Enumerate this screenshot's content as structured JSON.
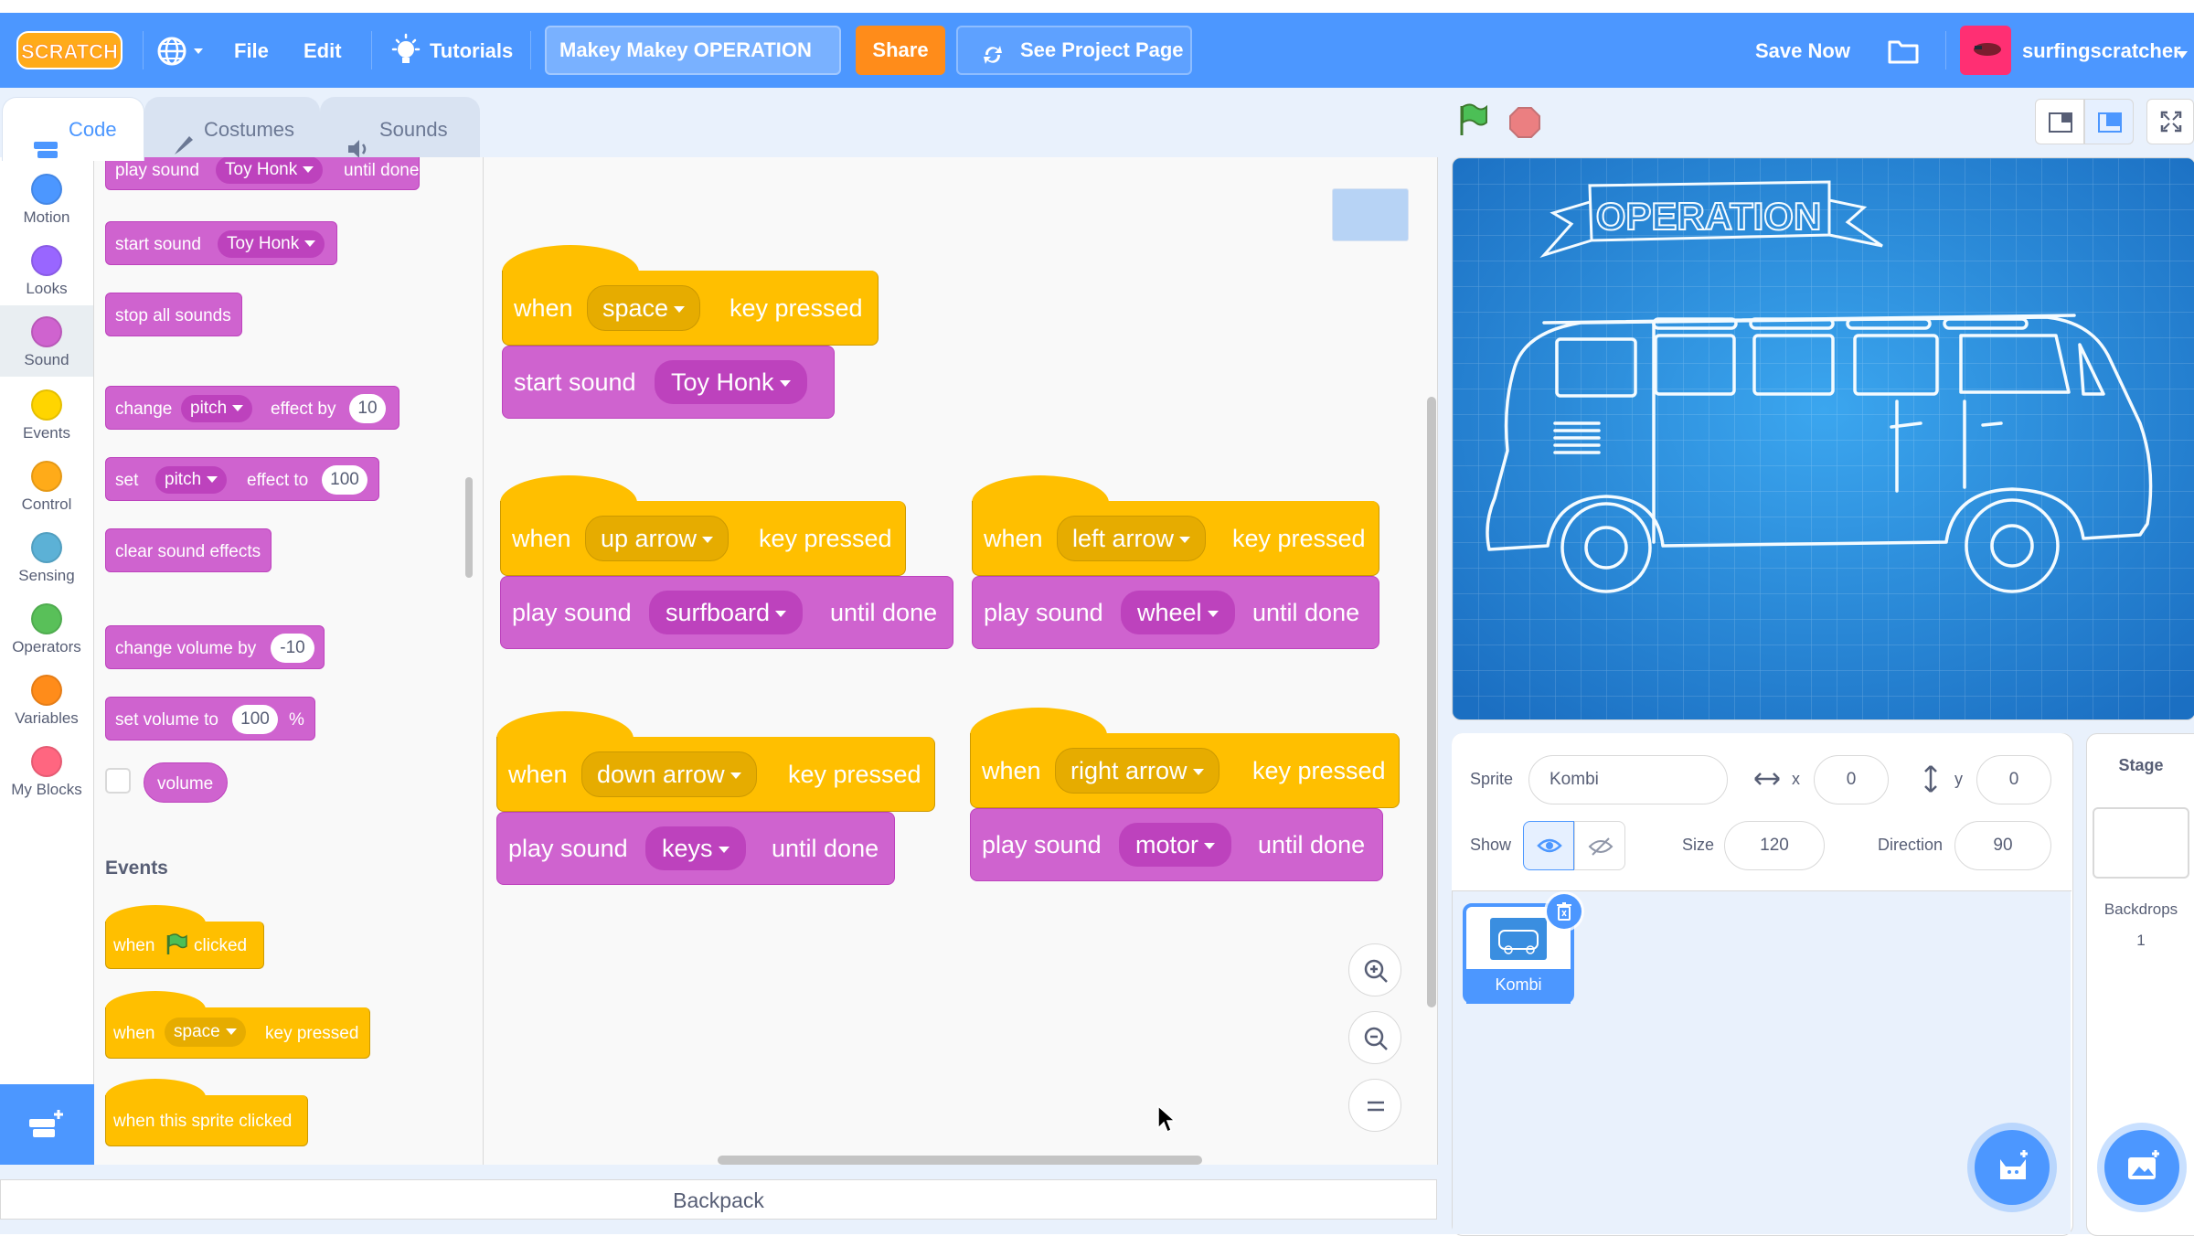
{
  "menubar": {
    "logo_text": "SCRATCH",
    "file": "File",
    "edit": "Edit",
    "tutorials": "Tutorials",
    "project_title": "Makey Makey OPERATION",
    "share": "Share",
    "see_project_page": "See Project Page",
    "save_now": "Save Now",
    "username": "surfingscratcher"
  },
  "tabs": {
    "code": "Code",
    "costumes": "Costumes",
    "sounds": "Sounds"
  },
  "categories": [
    {
      "label": "Motion",
      "color": "#4c97ff"
    },
    {
      "label": "Looks",
      "color": "#9966ff"
    },
    {
      "label": "Sound",
      "color": "#cf63cf"
    },
    {
      "label": "Events",
      "color": "#ffd500"
    },
    {
      "label": "Control",
      "color": "#ffab19"
    },
    {
      "label": "Sensing",
      "color": "#5cb1d6"
    },
    {
      "label": "Operators",
      "color": "#59c059"
    },
    {
      "label": "Variables",
      "color": "#ff8c1a"
    },
    {
      "label": "My Blocks",
      "color": "#ff6680"
    }
  ],
  "flyout": {
    "play_sound": "play sound",
    "toy_honk": "Toy Honk",
    "until_done": "until done",
    "start_sound": "start sound",
    "stop_all_sounds": "stop all sounds",
    "change": "change",
    "pitch": "pitch",
    "effect_by": "effect by",
    "ten": "10",
    "set": "set",
    "effect_to": "effect to",
    "hundred": "100",
    "clear_sound_effects": "clear sound effects",
    "change_volume_by": "change volume by",
    "minus_ten": "-10",
    "set_volume_to": "set volume to",
    "percent": "%",
    "volume": "volume",
    "events_heading": "Events",
    "when": "when",
    "clicked": "clicked",
    "space": "space",
    "key_pressed": "key pressed",
    "when_this_sprite_clicked": "when this sprite clicked"
  },
  "scripts": [
    {
      "key": "space",
      "action": "start sound",
      "sound": "Toy Honk",
      "suffix": ""
    },
    {
      "key": "up arrow",
      "action": "play sound",
      "sound": "surfboard",
      "suffix": "until done"
    },
    {
      "key": "left arrow",
      "action": "play sound",
      "sound": "wheel",
      "suffix": "until done"
    },
    {
      "key": "down arrow",
      "action": "play sound",
      "sound": "keys",
      "suffix": "until done"
    },
    {
      "key": "right arrow",
      "action": "play sound",
      "sound": "motor",
      "suffix": "until done"
    }
  ],
  "script_words": {
    "when": "when",
    "key_pressed": "key pressed"
  },
  "backpack": "Backpack",
  "stage": {
    "banner": "OPERATION"
  },
  "sprite_info": {
    "sprite_label": "Sprite",
    "sprite_name": "Kombi",
    "x_label": "x",
    "x": "0",
    "y_label": "y",
    "y": "0",
    "show_label": "Show",
    "size_label": "Size",
    "size": "120",
    "direction_label": "Direction",
    "direction": "90"
  },
  "sprites": [
    {
      "name": "Kombi"
    }
  ],
  "stage_pane": {
    "title": "Stage",
    "backdrops_label": "Backdrops",
    "backdrops_count": "1"
  },
  "colors": {
    "accent": "#4c97ff",
    "sound": "#cf63cf",
    "events": "#ffbf00",
    "share": "#ff8c1a"
  }
}
